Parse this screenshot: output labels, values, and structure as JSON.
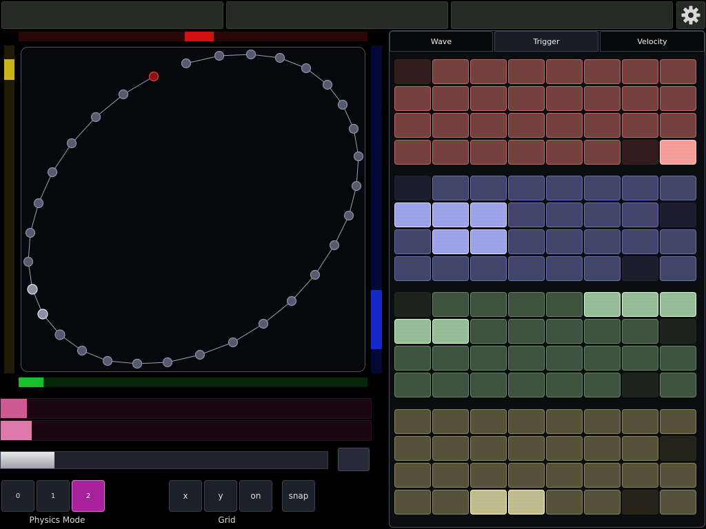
{
  "header": {
    "settings_icon": "gear-icon"
  },
  "tabs": [
    {
      "label": "Wave",
      "active": false
    },
    {
      "label": "Trigger",
      "active": true
    },
    {
      "label": "Velocity",
      "active": false
    }
  ],
  "physics": {
    "label": "Physics Mode",
    "options": [
      "0",
      "1",
      "2"
    ],
    "selected": "2"
  },
  "grid": {
    "label": "Grid",
    "x_label": "x",
    "y_label": "y",
    "on_label": "on",
    "snap_label": "snap"
  },
  "colors": {
    "red": "#c46f6a",
    "blue": "#6f74b4",
    "green": "#6a8c6a",
    "olive": "#8f8b62",
    "accent": "#b324a8"
  },
  "pad_banks": [
    {
      "name": "red",
      "levels": [
        [
          0,
          1,
          1,
          1,
          1,
          1,
          1,
          1
        ],
        [
          1,
          1,
          1,
          1,
          1,
          1,
          1,
          1
        ],
        [
          1,
          1,
          1,
          1,
          1,
          1,
          1,
          1
        ],
        [
          1,
          1,
          1,
          1,
          1,
          1,
          0,
          2
        ]
      ]
    },
    {
      "name": "blue",
      "levels": [
        [
          0,
          1,
          1,
          1,
          1,
          1,
          1,
          1
        ],
        [
          2,
          2,
          2,
          1,
          1,
          1,
          1,
          0
        ],
        [
          1,
          2,
          2,
          1,
          1,
          1,
          1,
          1
        ],
        [
          1,
          1,
          1,
          1,
          1,
          1,
          0,
          1
        ]
      ]
    },
    {
      "name": "green",
      "levels": [
        [
          0,
          1,
          1,
          1,
          1,
          2,
          2,
          2
        ],
        [
          2,
          2,
          1,
          1,
          1,
          1,
          1,
          0
        ],
        [
          1,
          1,
          1,
          1,
          1,
          1,
          1,
          1
        ],
        [
          1,
          1,
          1,
          1,
          1,
          1,
          0,
          1
        ]
      ]
    },
    {
      "name": "olive",
      "levels": [
        [
          1,
          1,
          1,
          1,
          1,
          1,
          1,
          1
        ],
        [
          1,
          1,
          1,
          1,
          1,
          1,
          1,
          0
        ],
        [
          1,
          1,
          1,
          1,
          1,
          1,
          1,
          1
        ],
        [
          1,
          1,
          2,
          2,
          1,
          1,
          0,
          1
        ]
      ]
    }
  ]
}
